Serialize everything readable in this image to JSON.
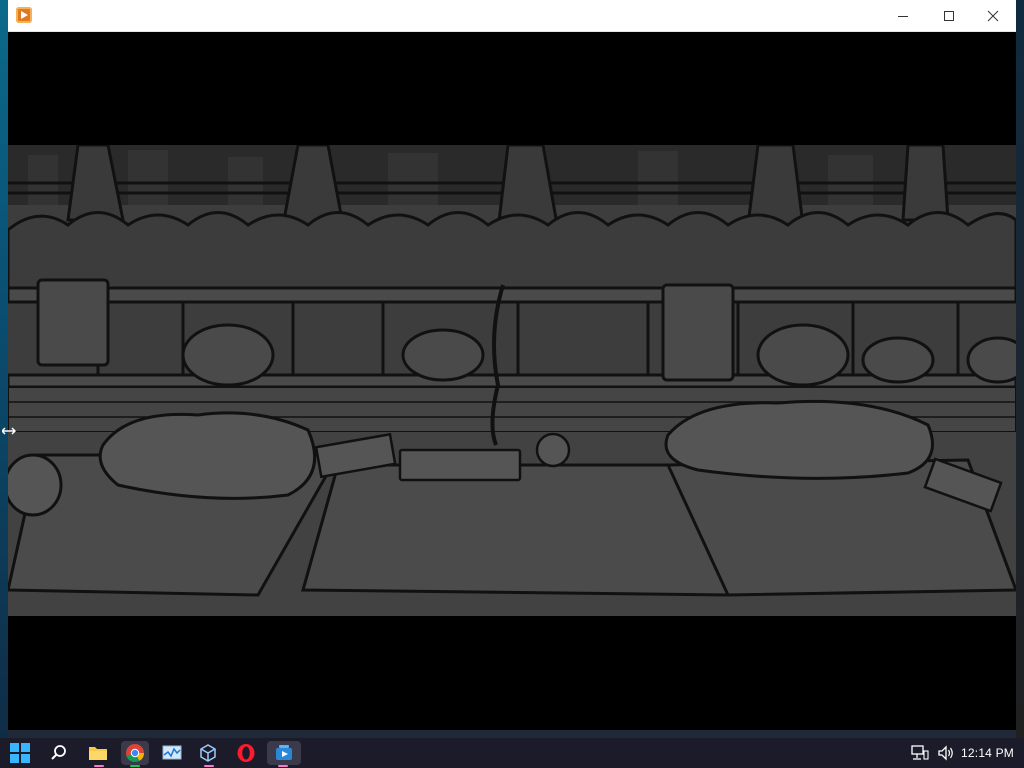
{
  "window": {
    "app_icon": "media-player-icon",
    "title": "",
    "controls": [
      "minimize-icon",
      "maximize-icon",
      "close-icon"
    ]
  },
  "video": {
    "scene": "illustrated-street-scene"
  },
  "taskbar": {
    "items": [
      {
        "name": "start",
        "icon": "windows-logo-icon"
      },
      {
        "name": "search",
        "icon": "search-icon"
      },
      {
        "name": "file-explorer",
        "icon": "folder-icon"
      },
      {
        "name": "chrome",
        "icon": "chrome-icon"
      },
      {
        "name": "monitor",
        "icon": "performance-monitor-icon"
      },
      {
        "name": "cube-app",
        "icon": "cube-icon"
      },
      {
        "name": "opera",
        "icon": "opera-icon"
      },
      {
        "name": "media-app",
        "icon": "media-app-icon"
      }
    ],
    "tray": {
      "network_icon": "network-icon",
      "volume_icon": "volume-icon",
      "time": "12:14 PM"
    }
  },
  "colors": {
    "taskbar_bg": "#1c1b2a",
    "titlebar_bg": "#ffffff",
    "accent": "#f77acb"
  }
}
